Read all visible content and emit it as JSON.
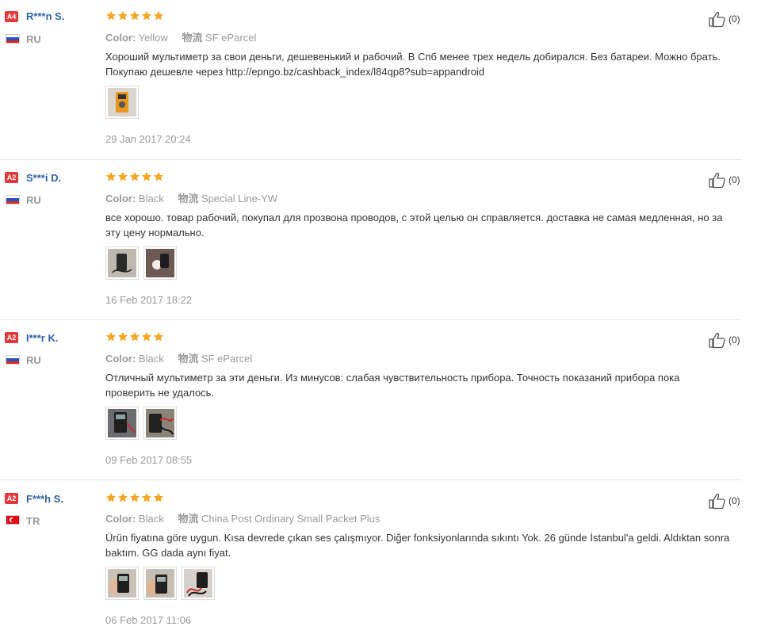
{
  "labels": {
    "color": "Color:",
    "shipping": "物流"
  },
  "colors": {
    "star": "#f5a623",
    "name": "#2f62a8",
    "badge": "#e4393c",
    "muted": "#999999"
  },
  "reviews": [
    {
      "badge": "A4",
      "name": "R***n S.",
      "country": "RU",
      "flag": "flag-ru-icon",
      "rating": 5,
      "color_value": "Yellow",
      "shipping_value": "SF eParcel",
      "text": "Хороший мультиметр за свои деньги, дешевенький и рабочий. В Спб менее трех недель добирался. Без батареи. Можно брать. Покупаю дешевле через http://epngo.bz/cashback_index/l84qp8?sub=appandroid",
      "photos": [
        "yellow-multimeter-photo"
      ],
      "date": "29 Jan 2017 20:24",
      "helpful_count": "(0)"
    },
    {
      "badge": "A2",
      "name": "S***i D.",
      "country": "RU",
      "flag": "flag-ru-icon",
      "rating": 5,
      "color_value": "Black",
      "shipping_value": "Special Line-YW",
      "text": "все хорошо. товар рабочий, покупал для прозвона проводов, с этой целью он справляется. доставка не самая медленная, но за эту цену нормально.",
      "photos": [
        "black-multimeter-photo",
        "black-multimeter-flash-photo"
      ],
      "date": "16 Feb 2017 18:22",
      "helpful_count": "(0)"
    },
    {
      "badge": "A2",
      "name": "I***r K.",
      "country": "RU",
      "flag": "flag-ru-icon",
      "rating": 5,
      "color_value": "Black",
      "shipping_value": "SF eParcel",
      "text": "Отличный мультиметр за эти деньги. Из минусов: слабая чувствительность прибора. Точность показаний прибора пока проверить не удалось.",
      "photos": [
        "multimeter-probes-photo",
        "multimeter-probes-photo-2"
      ],
      "date": "09 Feb 2017 08:55",
      "helpful_count": "(0)"
    },
    {
      "badge": "A2",
      "name": "F***h S.",
      "country": "TR",
      "flag": "flag-tr-icon",
      "rating": 5,
      "color_value": "Black",
      "shipping_value": "China Post Ordinary Small Packet Plus",
      "text": "Ürün fiyatına göre uygun. Kısa devrede çıkan ses çalışmıyor. Diğer fonksiyonlarında sıkıntı Yok. 26 günde İstanbul'a geldi. Aldıktan sonra baktım. GG dada aynı fiyat.",
      "photos": [
        "multimeter-hand-photo",
        "multimeter-hand-photo-2",
        "multimeter-leads-photo"
      ],
      "date": "06 Feb 2017 11:06",
      "helpful_count": "(0)"
    }
  ]
}
